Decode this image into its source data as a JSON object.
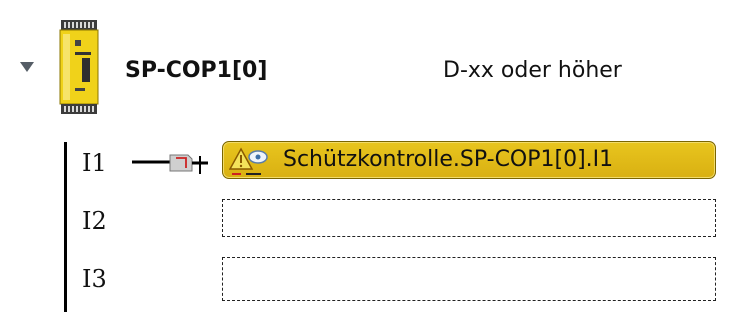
{
  "module": {
    "name": "SP-COP1[0]",
    "version": "D-xx oder höher",
    "icon": "safety-module-icon"
  },
  "inputs": [
    {
      "label": "I1",
      "assigned": "Schützkontrolle.SP-COP1[0].I1",
      "icon": "contactor-warning-icon"
    },
    {
      "label": "I2",
      "assigned": ""
    },
    {
      "label": "I3",
      "assigned": ""
    }
  ],
  "colors": {
    "slot_fill": "#e0bc18",
    "slot_border": "#7a6500",
    "module_yellow": "#f0d21a"
  }
}
